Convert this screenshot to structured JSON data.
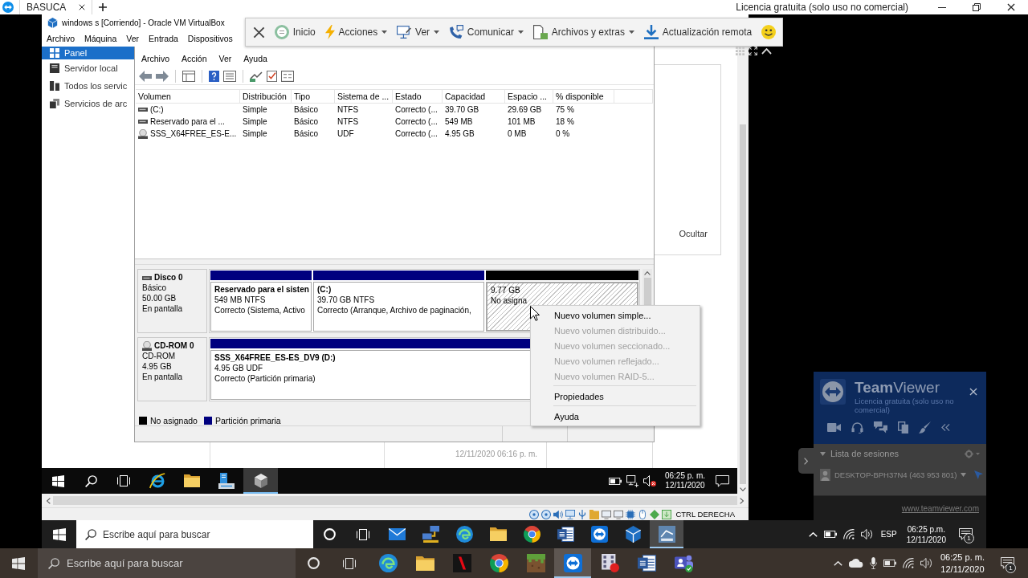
{
  "teamviewer_bar": {
    "tabs": [
      {
        "label": "BASUCA",
        "selected": true
      }
    ],
    "license": "Licencia gratuita (solo uso no comercial)"
  },
  "virtualbox": {
    "title": "windows s [Corriendo] - Oracle VM VirtualBox",
    "menu": [
      "Archivo",
      "Máquina",
      "Ver",
      "Entrada",
      "Dispositivos"
    ],
    "status_text": "CTRL DERECHA"
  },
  "remote_toolbar": {
    "items": [
      {
        "kind": "close"
      },
      {
        "kind": "home",
        "label": "Inicio",
        "dropdown": false
      },
      {
        "kind": "actions",
        "label": "Acciones",
        "dropdown": true
      },
      {
        "kind": "view",
        "label": "Ver",
        "dropdown": true
      },
      {
        "kind": "communicate",
        "label": "Comunicar",
        "dropdown": true
      },
      {
        "kind": "files",
        "label": "Archivos y extras",
        "dropdown": true
      },
      {
        "kind": "update",
        "label": "Actualización remota",
        "dropdown": false
      },
      {
        "kind": "smiley"
      }
    ]
  },
  "server_manager": {
    "nav": [
      {
        "label": "Panel",
        "selected": true
      },
      {
        "label": "Servidor local",
        "selected": false
      },
      {
        "label": "Todos los servic",
        "selected": false
      },
      {
        "label": "Servicios de arc",
        "selected": false
      }
    ],
    "hide_button": "Ocultar",
    "timestamp": "12/11/2020 06:16 p. m."
  },
  "disk_management": {
    "menu": [
      "Archivo",
      "Acción",
      "Ver",
      "Ayuda"
    ],
    "table": {
      "columns": [
        "Volumen",
        "Distribución",
        "Tipo",
        "Sistema de ...",
        "Estado",
        "Capacidad",
        "Espacio ...",
        "% disponible"
      ],
      "rows": [
        {
          "kind": "volume",
          "cells": [
            "(C:)",
            "Simple",
            "Básico",
            "NTFS",
            "Correcto (...",
            "39.70 GB",
            "29.69 GB",
            "75 %"
          ]
        },
        {
          "kind": "volume",
          "cells": [
            "Reservado para el ...",
            "Simple",
            "Básico",
            "NTFS",
            "Correcto (...",
            "549 MB",
            "101 MB",
            "18 %"
          ]
        },
        {
          "kind": "optical",
          "cells": [
            "SSS_X64FREE_ES-E...",
            "Simple",
            "Básico",
            "UDF",
            "Correcto (...",
            "4.95 GB",
            "0 MB",
            "0 %"
          ]
        }
      ]
    },
    "disks": [
      {
        "kind": "disk",
        "name": "Disco 0",
        "details": [
          "Básico",
          "50.00 GB",
          "En pantalla"
        ],
        "partitions": [
          {
            "kind": "primary",
            "selected": false,
            "title": "Reservado para el sisten",
            "details": [
              "549 MB NTFS",
              "Correcto (Sistema, Activo"
            ]
          },
          {
            "kind": "primary",
            "selected": false,
            "title": "(C:)",
            "details": [
              "39.70 GB NTFS",
              "Correcto (Arranque, Archivo de paginación,"
            ]
          },
          {
            "kind": "unallocated",
            "selected": true,
            "details": [
              "9.77 GB",
              "No asigna"
            ]
          }
        ]
      },
      {
        "kind": "cdrom",
        "name": "CD-ROM 0",
        "details": [
          "CD-ROM",
          "4.95 GB",
          "En pantalla"
        ],
        "partitions": [
          {
            "kind": "primary",
            "selected": false,
            "title": "SSS_X64FREE_ES-ES_DV9 (D:)",
            "details": [
              "4.95 GB UDF",
              "Correcto (Partición primaria)"
            ]
          }
        ]
      }
    ],
    "legend": [
      {
        "kind": "unallocated",
        "label": "No asignado",
        "color": "#000000"
      },
      {
        "kind": "primary",
        "label": "Partición primaria",
        "color": "#00007f"
      }
    ]
  },
  "context_menu": {
    "groups": [
      [
        {
          "label": "Nuevo volumen simple...",
          "disabled": false
        },
        {
          "label": "Nuevo volumen distribuido...",
          "disabled": true
        },
        {
          "label": "Nuevo volumen seccionado...",
          "disabled": true
        },
        {
          "label": "Nuevo volumen reflejado...",
          "disabled": true
        },
        {
          "label": "Nuevo volumen RAID-5...",
          "disabled": true
        }
      ],
      [
        {
          "label": "Propiedades",
          "disabled": false
        }
      ],
      [
        {
          "label": "Ayuda",
          "disabled": false
        }
      ]
    ]
  },
  "guest_taskbar": {
    "apps": [
      {
        "kind": "browser",
        "selected": false
      },
      {
        "kind": "folder",
        "selected": false
      },
      {
        "kind": "server",
        "selected": false
      },
      {
        "kind": "package",
        "selected": true
      }
    ],
    "time": "06:25 p. m.",
    "date": "12/11/2020"
  },
  "remote_taskbar": {
    "search": {
      "placeholder": "Escribe aquí para buscar"
    },
    "apps": [
      {
        "kind": "mail",
        "selected": false
      },
      {
        "kind": "network",
        "selected": false
      },
      {
        "kind": "edge",
        "selected": false
      },
      {
        "kind": "folder",
        "selected": false
      },
      {
        "kind": "chrome",
        "selected": false
      },
      {
        "kind": "word",
        "selected": false
      },
      {
        "kind": "teamviewer",
        "selected": false
      },
      {
        "kind": "virtualbox",
        "selected": false
      },
      {
        "kind": "server2016",
        "selected": true
      }
    ],
    "language": "ESP",
    "time": "06:25 p.m.",
    "date": "12/11/2020",
    "notifications": "1"
  },
  "teamviewer_panel": {
    "title": "**Team**Viewer",
    "license": "Licencia gratuita (solo uso no comercial)",
    "sessions_header": "Lista de sesiones",
    "expanded": true,
    "sessions": [
      "DESKTOP-BPH37N4 (463 953 801)"
    ],
    "link": "www.teamviewer.com"
  },
  "local_taskbar": {
    "search": {
      "placeholder": "Escribe aquí para buscar"
    },
    "apps": [
      {
        "kind": "edge",
        "selected": false
      },
      {
        "kind": "folder",
        "selected": false
      },
      {
        "kind": "netflix",
        "selected": false
      },
      {
        "kind": "chrome",
        "selected": false
      },
      {
        "kind": "minecraft",
        "selected": false
      },
      {
        "kind": "teamviewer",
        "selected": true
      },
      {
        "kind": "video",
        "selected": false
      },
      {
        "kind": "word",
        "selected": false
      },
      {
        "kind": "teams",
        "selected": false
      }
    ],
    "time": "06:25 p. m.",
    "date": "12/11/2020",
    "notifications": "1"
  }
}
